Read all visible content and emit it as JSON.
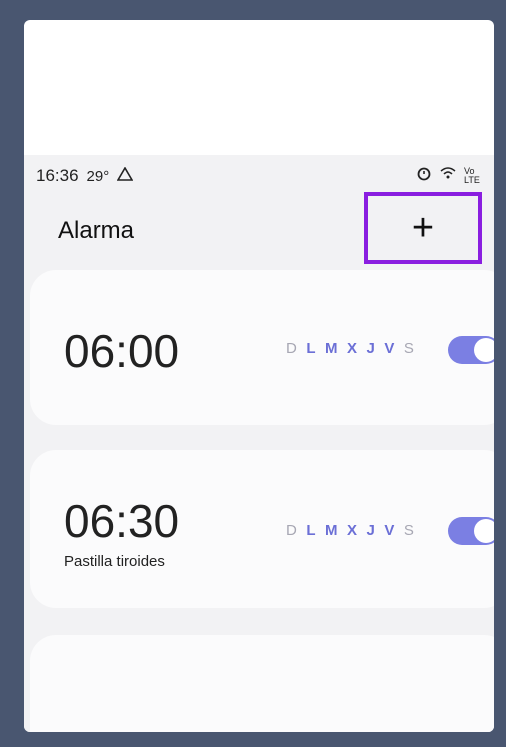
{
  "status_bar": {
    "time": "16:36",
    "temp": "29°",
    "signal_text": "Vo LTE"
  },
  "header": {
    "title": "Alarma",
    "add_label": "+",
    "more_label": "⋮"
  },
  "alarms": [
    {
      "time": "06:00",
      "label": "",
      "days": [
        {
          "d": "D",
          "active": false
        },
        {
          "d": "L",
          "active": true
        },
        {
          "d": "M",
          "active": true
        },
        {
          "d": "X",
          "active": true
        },
        {
          "d": "J",
          "active": true
        },
        {
          "d": "V",
          "active": true
        },
        {
          "d": "S",
          "active": false
        }
      ],
      "enabled": true
    },
    {
      "time": "06:30",
      "label": "Pastilla tiroides",
      "days": [
        {
          "d": "D",
          "active": false
        },
        {
          "d": "L",
          "active": true
        },
        {
          "d": "M",
          "active": true
        },
        {
          "d": "X",
          "active": true
        },
        {
          "d": "J",
          "active": true
        },
        {
          "d": "V",
          "active": true
        },
        {
          "d": "S",
          "active": false
        }
      ],
      "enabled": true
    }
  ],
  "colors": {
    "accent": "#7b7fe3",
    "highlight": "#8a1ee0",
    "frame": "#495670"
  }
}
